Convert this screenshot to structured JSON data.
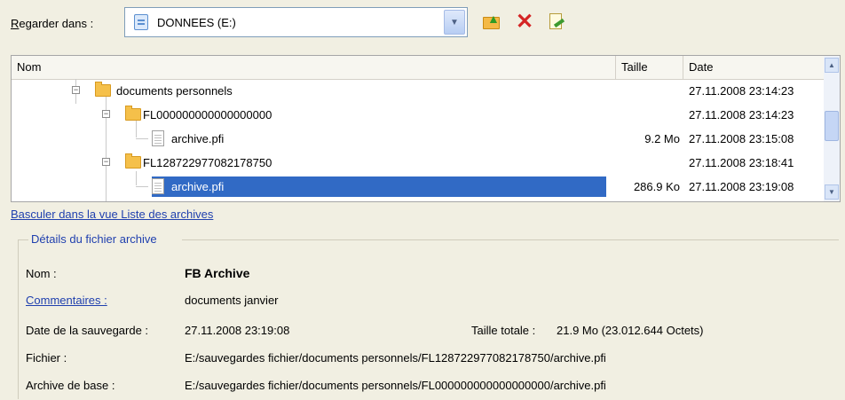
{
  "toolbar": {
    "lookin_accel": "R",
    "lookin_rest": "egarder dans :",
    "drive_value": "DONNEES (E:)",
    "up_button_icon": "folder-up-icon",
    "delete_button_icon": "delete-x-icon",
    "properties_button_icon": "properties-icon"
  },
  "list": {
    "columns": {
      "name": "Nom",
      "size": "Taille",
      "date": "Date"
    },
    "rows": [
      {
        "name": "documents personnels",
        "size": "",
        "date": "27.11.2008 23:14:23",
        "type": "folder"
      },
      {
        "name": "FL000000000000000000",
        "size": "",
        "date": "27.11.2008 23:14:23",
        "type": "folder"
      },
      {
        "name": "archive.pfi",
        "size": "9.2 Mo",
        "date": "27.11.2008 23:15:08",
        "type": "file"
      },
      {
        "name": "FL128722977082178750",
        "size": "",
        "date": "27.11.2008 23:18:41",
        "type": "folder"
      },
      {
        "name": "archive.pfi",
        "size": "286.9 Ko",
        "date": "27.11.2008 23:19:08",
        "type": "file",
        "selected": true
      }
    ]
  },
  "switch_view_link": "Basculer dans la vue Liste des archives",
  "details": {
    "title": "Détails du fichier archive",
    "name_label": "Nom :",
    "name_value": "FB Archive",
    "comments_label": "Commentaires :",
    "comments_value": "documents janvier",
    "backup_date_label": "Date de la sauvegarde :",
    "backup_date_value": "27.11.2008 23:19:08",
    "total_size_label": "Taille totale :",
    "total_size_value": "21.9 Mo (23.012.644 Octets)",
    "file_label": "Fichier :",
    "file_value": "E:/sauvegardes fichier/documents personnels/FL128722977082178750/archive.pfi",
    "base_archive_label": "Archive de base :",
    "base_archive_value": "E:/sauvegardes fichier/documents personnels/FL000000000000000000/archive.pfi"
  }
}
